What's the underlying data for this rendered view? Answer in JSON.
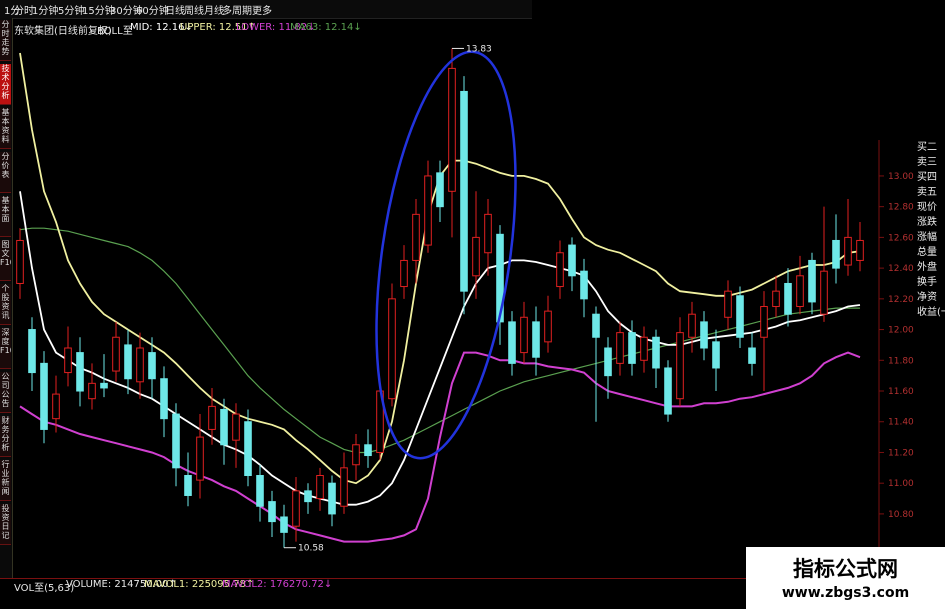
{
  "topbar": {
    "tabs": [
      "1分",
      "分时",
      "1分钟",
      "5分钟",
      "15分钟",
      "30分钟",
      "60分钟",
      "日线",
      "周线",
      "月线",
      "多周期",
      "更多"
    ]
  },
  "indicator": {
    "name": "东软集团(日线前复权)",
    "boll": "BOLL至",
    "mid": "MID: 12.16↓",
    "upper": "UPPER: 12.51↑",
    "lower": "LOWER: 11.82↓",
    "ma63": "MA63: 12.14↓"
  },
  "left_tabs": [
    "分时走势",
    "技术分析",
    "基本资料",
    "分价表",
    "基本面",
    "图文F10",
    "个股资讯",
    "深度F10",
    "公司公告",
    "财务分析",
    "行业新闻",
    "投资日记"
  ],
  "right_panel": [
    "买二",
    "卖三",
    "买四",
    "卖五",
    "现价",
    "涨跌",
    "涨幅",
    "总量",
    "外盘",
    "换手",
    "净资",
    "收益(一)"
  ],
  "volume": {
    "name": "VOL至(5,63)",
    "volume": "VOLUME: 214750.00↑",
    "mavol1": "MAVOL1: 225095.78↑",
    "mavol2": "MAVOL2: 176270.72↓"
  },
  "watermark": {
    "title": "指标公式网",
    "url": "www.zbgs3.com"
  },
  "colors": {
    "up": "#e02020",
    "down": "#6ee8e8",
    "upper_band": "#f0f0a0",
    "mid_band": "#ffffff",
    "lower_band": "#d040d0",
    "ma63": "#5aa050",
    "annotation": "#2233dd"
  },
  "chart_data": {
    "type": "candlestick",
    "title": "",
    "ylim": [
      10.5,
      13.95
    ],
    "y_ticks": [
      "13.00",
      "12.80",
      "12.60",
      "12.40",
      "12.20",
      "12.00",
      "11.80",
      "11.60",
      "11.40",
      "11.20",
      "11.00",
      "10.80"
    ],
    "annotations": [
      {
        "label": "13.83",
        "y": 13.83
      },
      {
        "label": "10.58",
        "y": 10.58
      }
    ],
    "candles": [
      {
        "o": 12.3,
        "c": 12.58,
        "h": 12.66,
        "l": 12.2
      },
      {
        "o": 12.0,
        "c": 11.72,
        "h": 12.08,
        "l": 11.6
      },
      {
        "o": 11.78,
        "c": 11.35,
        "h": 11.86,
        "l": 11.26
      },
      {
        "o": 11.42,
        "c": 11.58,
        "h": 11.7,
        "l": 11.33
      },
      {
        "o": 11.72,
        "c": 11.88,
        "h": 12.02,
        "l": 11.63
      },
      {
        "o": 11.85,
        "c": 11.6,
        "h": 11.95,
        "l": 11.5
      },
      {
        "o": 11.55,
        "c": 11.65,
        "h": 11.78,
        "l": 11.48
      },
      {
        "o": 11.65,
        "c": 11.62,
        "h": 11.84,
        "l": 11.56
      },
      {
        "o": 11.73,
        "c": 11.95,
        "h": 12.05,
        "l": 11.66
      },
      {
        "o": 11.9,
        "c": 11.68,
        "h": 12.0,
        "l": 11.58
      },
      {
        "o": 11.66,
        "c": 11.88,
        "h": 11.98,
        "l": 11.55
      },
      {
        "o": 11.85,
        "c": 11.68,
        "h": 11.95,
        "l": 11.55
      },
      {
        "o": 11.68,
        "c": 11.42,
        "h": 11.76,
        "l": 11.3
      },
      {
        "o": 11.45,
        "c": 11.1,
        "h": 11.52,
        "l": 10.98
      },
      {
        "o": 11.05,
        "c": 10.92,
        "h": 11.2,
        "l": 10.85
      },
      {
        "o": 11.02,
        "c": 11.3,
        "h": 11.45,
        "l": 10.9
      },
      {
        "o": 11.35,
        "c": 11.5,
        "h": 11.62,
        "l": 11.25
      },
      {
        "o": 11.48,
        "c": 11.25,
        "h": 11.55,
        "l": 11.12
      },
      {
        "o": 11.28,
        "c": 11.45,
        "h": 11.52,
        "l": 11.1
      },
      {
        "o": 11.4,
        "c": 11.05,
        "h": 11.48,
        "l": 10.98
      },
      {
        "o": 11.05,
        "c": 10.85,
        "h": 11.12,
        "l": 10.75
      },
      {
        "o": 10.88,
        "c": 10.75,
        "h": 10.95,
        "l": 10.65
      },
      {
        "o": 10.78,
        "c": 10.68,
        "h": 10.86,
        "l": 10.58
      },
      {
        "o": 10.72,
        "c": 10.95,
        "h": 11.04,
        "l": 10.62
      },
      {
        "o": 10.95,
        "c": 10.88,
        "h": 11.0,
        "l": 10.8
      },
      {
        "o": 10.9,
        "c": 11.05,
        "h": 11.1,
        "l": 10.82
      },
      {
        "o": 11.0,
        "c": 10.8,
        "h": 11.05,
        "l": 10.72
      },
      {
        "o": 10.85,
        "c": 11.1,
        "h": 11.2,
        "l": 10.8
      },
      {
        "o": 11.12,
        "c": 11.25,
        "h": 11.32,
        "l": 11.02
      },
      {
        "o": 11.25,
        "c": 11.18,
        "h": 11.35,
        "l": 11.1
      },
      {
        "o": 11.2,
        "c": 11.6,
        "h": 11.68,
        "l": 11.15
      },
      {
        "o": 11.55,
        "c": 12.2,
        "h": 12.3,
        "l": 11.5
      },
      {
        "o": 12.28,
        "c": 12.45,
        "h": 12.55,
        "l": 12.2
      },
      {
        "o": 12.45,
        "c": 12.75,
        "h": 12.85,
        "l": 12.3
      },
      {
        "o": 12.55,
        "c": 13.0,
        "h": 13.1,
        "l": 12.5
      },
      {
        "o": 13.02,
        "c": 12.8,
        "h": 13.1,
        "l": 12.7
      },
      {
        "o": 12.9,
        "c": 13.7,
        "h": 13.83,
        "l": 12.6
      },
      {
        "o": 13.55,
        "c": 12.25,
        "h": 13.65,
        "l": 12.1
      },
      {
        "o": 12.35,
        "c": 12.6,
        "h": 12.9,
        "l": 12.2
      },
      {
        "o": 12.5,
        "c": 12.75,
        "h": 12.85,
        "l": 12.35
      },
      {
        "o": 12.62,
        "c": 12.05,
        "h": 12.68,
        "l": 11.9
      },
      {
        "o": 12.05,
        "c": 11.78,
        "h": 12.12,
        "l": 11.7
      },
      {
        "o": 11.85,
        "c": 12.08,
        "h": 12.18,
        "l": 11.78
      },
      {
        "o": 12.05,
        "c": 11.82,
        "h": 12.15,
        "l": 11.7
      },
      {
        "o": 11.92,
        "c": 12.12,
        "h": 12.22,
        "l": 11.85
      },
      {
        "o": 12.28,
        "c": 12.5,
        "h": 12.58,
        "l": 12.2
      },
      {
        "o": 12.55,
        "c": 12.35,
        "h": 12.6,
        "l": 12.25
      },
      {
        "o": 12.38,
        "c": 12.2,
        "h": 12.46,
        "l": 12.08
      },
      {
        "o": 12.1,
        "c": 11.95,
        "h": 12.15,
        "l": 11.4
      },
      {
        "o": 11.88,
        "c": 11.7,
        "h": 11.95,
        "l": 11.55
      },
      {
        "o": 11.78,
        "c": 11.98,
        "h": 12.05,
        "l": 11.7
      },
      {
        "o": 11.98,
        "c": 11.78,
        "h": 12.06,
        "l": 11.7
      },
      {
        "o": 11.8,
        "c": 11.95,
        "h": 12.02,
        "l": 11.72
      },
      {
        "o": 11.95,
        "c": 11.75,
        "h": 12.0,
        "l": 11.62
      },
      {
        "o": 11.75,
        "c": 11.45,
        "h": 11.8,
        "l": 11.4
      },
      {
        "o": 11.55,
        "c": 11.98,
        "h": 12.08,
        "l": 11.5
      },
      {
        "o": 11.95,
        "c": 12.1,
        "h": 12.18,
        "l": 11.85
      },
      {
        "o": 12.05,
        "c": 11.88,
        "h": 12.12,
        "l": 11.8
      },
      {
        "o": 11.92,
        "c": 11.75,
        "h": 12.0,
        "l": 11.6
      },
      {
        "o": 12.08,
        "c": 12.25,
        "h": 12.32,
        "l": 12.0
      },
      {
        "o": 12.22,
        "c": 11.95,
        "h": 12.28,
        "l": 11.88
      },
      {
        "o": 11.88,
        "c": 11.78,
        "h": 11.98,
        "l": 11.7
      },
      {
        "o": 11.95,
        "c": 12.15,
        "h": 12.25,
        "l": 11.6
      },
      {
        "o": 12.15,
        "c": 12.25,
        "h": 12.35,
        "l": 12.08
      },
      {
        "o": 12.3,
        "c": 12.1,
        "h": 12.4,
        "l": 12.02
      },
      {
        "o": 12.15,
        "c": 12.35,
        "h": 12.48,
        "l": 12.1
      },
      {
        "o": 12.45,
        "c": 12.18,
        "h": 12.5,
        "l": 12.1
      },
      {
        "o": 12.1,
        "c": 12.38,
        "h": 12.8,
        "l": 12.05
      },
      {
        "o": 12.58,
        "c": 12.4,
        "h": 12.75,
        "l": 12.3
      },
      {
        "o": 12.42,
        "c": 12.6,
        "h": 12.85,
        "l": 12.35
      },
      {
        "o": 12.45,
        "c": 12.58,
        "h": 12.7,
        "l": 12.38
      }
    ],
    "series": [
      {
        "name": "UPPER",
        "color": "#f0f0a0",
        "values": [
          13.8,
          13.3,
          12.9,
          12.7,
          12.45,
          12.3,
          12.18,
          12.1,
          12.05,
          12.0,
          11.95,
          11.9,
          11.85,
          11.78,
          11.7,
          11.62,
          11.55,
          11.5,
          11.45,
          11.42,
          11.4,
          11.38,
          11.35,
          11.28,
          11.22,
          11.15,
          11.08,
          11.02,
          11.0,
          11.05,
          11.15,
          11.4,
          11.8,
          12.3,
          12.75,
          13.0,
          13.1,
          13.1,
          13.08,
          13.05,
          13.02,
          13.0,
          13.0,
          12.98,
          12.95,
          12.85,
          12.72,
          12.6,
          12.55,
          12.52,
          12.5,
          12.46,
          12.42,
          12.38,
          12.3,
          12.25,
          12.24,
          12.23,
          12.22,
          12.22,
          12.24,
          12.26,
          12.3,
          12.34,
          12.38,
          12.4,
          12.42,
          12.42,
          12.44,
          12.5,
          12.51
        ]
      },
      {
        "name": "MID",
        "color": "#ffffff",
        "values": [
          12.9,
          12.4,
          12.0,
          11.85,
          11.8,
          11.75,
          11.72,
          11.68,
          11.65,
          11.62,
          11.58,
          11.55,
          11.5,
          11.45,
          11.4,
          11.35,
          11.3,
          11.25,
          11.22,
          11.18,
          11.12,
          11.05,
          11.0,
          10.95,
          10.92,
          10.9,
          10.88,
          10.86,
          10.86,
          10.88,
          10.92,
          11.0,
          11.15,
          11.35,
          11.55,
          11.75,
          11.95,
          12.15,
          12.3,
          12.4,
          12.42,
          12.45,
          12.45,
          12.44,
          12.42,
          12.4,
          12.38,
          12.35,
          12.25,
          12.12,
          12.04,
          11.98,
          11.94,
          11.92,
          11.9,
          11.9,
          11.92,
          11.94,
          11.95,
          11.96,
          11.97,
          11.98,
          12.0,
          12.02,
          12.05,
          12.06,
          12.08,
          12.1,
          12.12,
          12.15,
          12.16
        ]
      },
      {
        "name": "LOWER",
        "color": "#d040d0",
        "values": [
          11.5,
          11.45,
          11.4,
          11.38,
          11.35,
          11.32,
          11.3,
          11.28,
          11.26,
          11.24,
          11.22,
          11.2,
          11.17,
          11.12,
          11.08,
          11.05,
          11.02,
          10.98,
          10.95,
          10.9,
          10.85,
          10.8,
          10.74,
          10.7,
          10.68,
          10.66,
          10.64,
          10.62,
          10.62,
          10.62,
          10.63,
          10.64,
          10.66,
          10.7,
          10.9,
          11.3,
          11.65,
          11.85,
          11.85,
          11.83,
          11.8,
          11.8,
          11.78,
          11.78,
          11.76,
          11.75,
          11.74,
          11.72,
          11.65,
          11.6,
          11.58,
          11.56,
          11.54,
          11.52,
          11.5,
          11.5,
          11.5,
          11.52,
          11.52,
          11.53,
          11.55,
          11.56,
          11.58,
          11.6,
          11.62,
          11.65,
          11.7,
          11.78,
          11.82,
          11.85,
          11.82
        ]
      },
      {
        "name": "MA63",
        "color": "#5aa050",
        "values": [
          12.65,
          12.66,
          12.66,
          12.65,
          12.64,
          12.62,
          12.6,
          12.58,
          12.56,
          12.54,
          12.5,
          12.45,
          12.38,
          12.3,
          12.2,
          12.1,
          12.0,
          11.9,
          11.8,
          11.7,
          11.62,
          11.55,
          11.48,
          11.42,
          11.36,
          11.3,
          11.26,
          11.22,
          11.2,
          11.2,
          11.22,
          11.25,
          11.28,
          11.32,
          11.36,
          11.4,
          11.44,
          11.48,
          11.52,
          11.56,
          11.6,
          11.63,
          11.66,
          11.68,
          11.7,
          11.72,
          11.74,
          11.76,
          11.78,
          11.8,
          11.82,
          11.84,
          11.86,
          11.88,
          11.9,
          11.92,
          11.94,
          11.96,
          11.98,
          12.0,
          12.02,
          12.04,
          12.06,
          12.08,
          12.1,
          12.11,
          12.12,
          12.13,
          12.14,
          12.14,
          12.14
        ]
      }
    ]
  }
}
